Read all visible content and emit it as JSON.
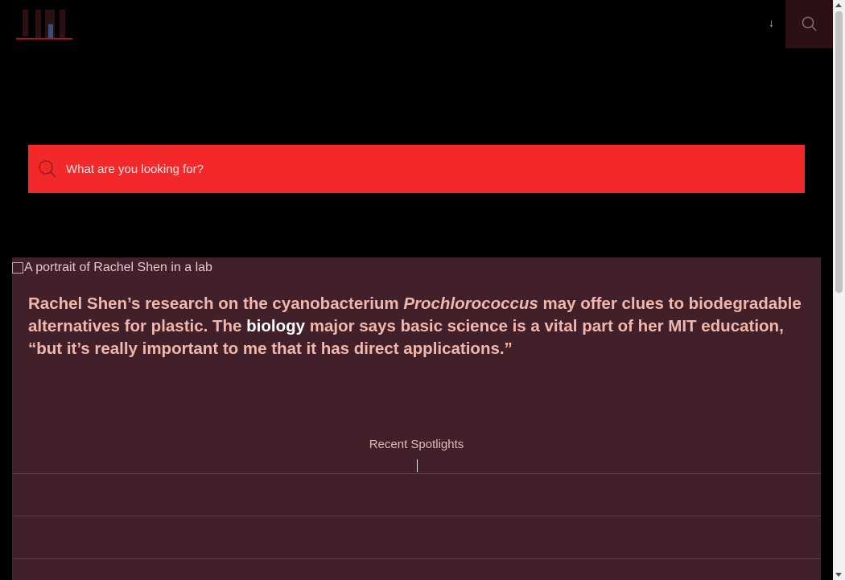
{
  "header": {
    "logo_icon": "mit-logo",
    "arrow_glyph": "↓",
    "search_button_icon": "search-icon"
  },
  "search": {
    "placeholder": "What are you looking for?",
    "icon": "search-icon"
  },
  "feature": {
    "image_alt": "A portrait of Rachel Shen in a lab",
    "quote_part1": "Rachel Shen’s research on the cyanobacterium ",
    "quote_italic": "Prochlorococcus",
    "quote_part2": " may offer clues to biodegradable alternatives for plastic. The ",
    "quote_link": "biology",
    "quote_part3": " major says basic science is a vital part of her MIT education, “but it’s really important to me that it has direct applications.”"
  },
  "recent_spotlights": {
    "title": "Recent Spotlights"
  },
  "colors": {
    "accent_red": "#f2282b",
    "panel_bg": "#42202a",
    "quote_text": "#f0b7ad",
    "header_button_bg": "#2b1014"
  }
}
